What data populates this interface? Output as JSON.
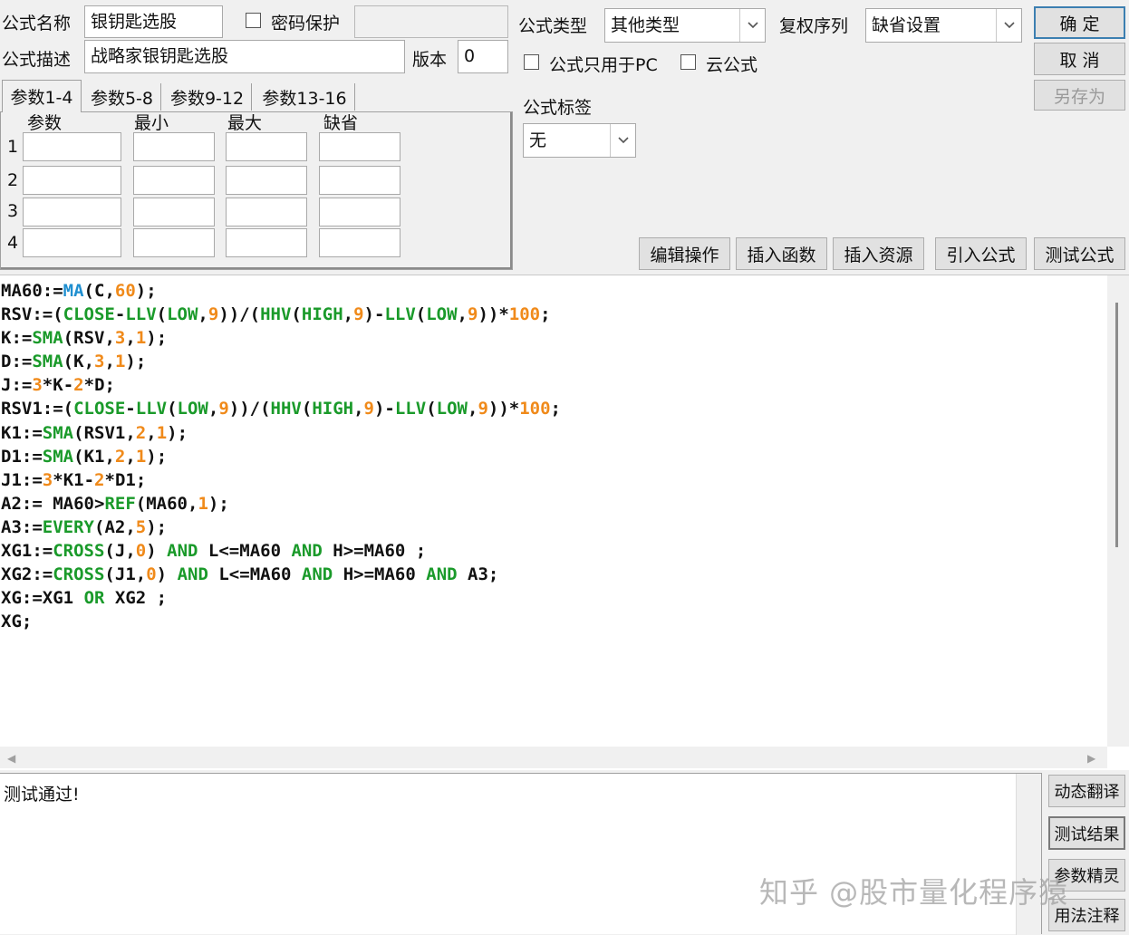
{
  "form": {
    "name_label": "公式名称",
    "name_value": "银钥匙选股",
    "password_label": "密码保护",
    "password_checked": false,
    "desc_label": "公式描述",
    "desc_value": "战略家银钥匙选股",
    "version_label": "版本",
    "version_value": "0",
    "type_label": "公式类型",
    "type_value": "其他类型",
    "fuquan_label": "复权序列",
    "fuquan_value": "缺省设置",
    "pc_only_label": "公式只用于PC",
    "cloud_label": "云公式",
    "tag_label": "公式标签",
    "tag_value": "无"
  },
  "buttons": {
    "ok": "确 定",
    "cancel": "取 消",
    "save_as": "另存为",
    "edit_ops": "编辑操作",
    "insert_func": "插入函数",
    "insert_res": "插入资源",
    "import_formula": "引入公式",
    "test_formula": "测试公式",
    "dynamic_translate": "动态翻译",
    "test_result": "测试结果",
    "param_wizard": "参数精灵",
    "usage_notes": "用法注释"
  },
  "tabs": [
    "参数1-4",
    "参数5-8",
    "参数9-12",
    "参数13-16"
  ],
  "params": {
    "headers": [
      "参数",
      "最小",
      "最大",
      "缺省"
    ],
    "rows": [
      "1",
      "2",
      "3",
      "4"
    ]
  },
  "code_lines": [
    "MA60:=MA(C,60);",
    "RSV:=(CLOSE-LLV(LOW,9))/(HHV(HIGH,9)-LLV(LOW,9))*100;",
    "K:=SMA(RSV,3,1);",
    "D:=SMA(K,3,1);",
    "J:=3*K-2*D;",
    "RSV1:=(CLOSE-LLV(LOW,9))/(HHV(HIGH,9)-LLV(LOW,9))*100;",
    "K1:=SMA(RSV1,2,1);",
    "D1:=SMA(K1,2,1);",
    "J1:=3*K1-2*D1;",
    "A2:= MA60>REF(MA60,1);",
    "A3:=EVERY(A2,5);",
    "XG1:=CROSS(J,0) AND L<=MA60 AND H>=MA60 ;",
    "XG2:=CROSS(J1,0) AND L<=MA60 AND H>=MA60 AND A3;",
    "XG:=XG1 OR XG2 ;",
    "XG;"
  ],
  "output_text": "测试通过!",
  "watermark": "知乎 @股市量化程序猿",
  "colors": {
    "function": "#1a9a2a",
    "number": "#f08a1a",
    "ma_function": "#1f8fd0",
    "default_button_border": "#3c7fb1"
  }
}
